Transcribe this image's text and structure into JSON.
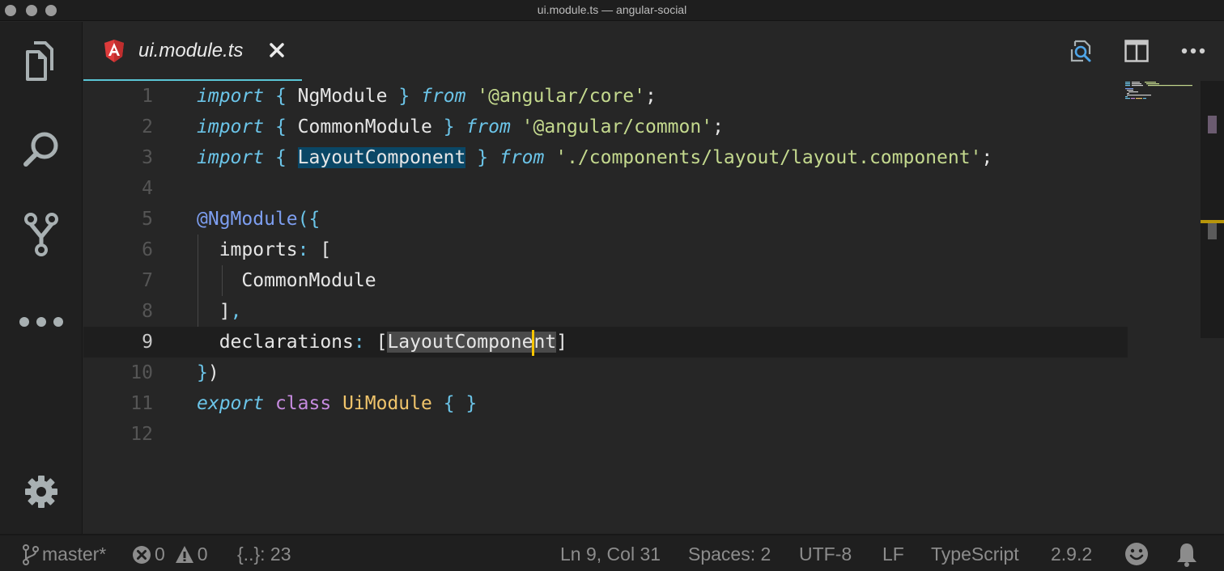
{
  "window": {
    "title": "ui.module.ts — angular-social"
  },
  "activity_bar": {
    "items": [
      {
        "name": "explorer",
        "icon": "files-icon"
      },
      {
        "name": "search",
        "icon": "search-icon"
      },
      {
        "name": "source-control",
        "icon": "source-control-icon"
      },
      {
        "name": "more",
        "icon": "more-icon"
      }
    ],
    "bottom": {
      "name": "settings",
      "icon": "gear-icon"
    }
  },
  "tabs": [
    {
      "label": "ui.module.ts",
      "icon": "angular-icon",
      "active": true,
      "close_icon": "close-icon"
    }
  ],
  "editor_actions": [
    {
      "name": "open-changes",
      "icon": "search-file-icon"
    },
    {
      "name": "split-editor",
      "icon": "split-editor-icon"
    },
    {
      "name": "more-actions",
      "icon": "ellipsis-icon"
    }
  ],
  "editor": {
    "current_line": 9,
    "line_numbers": [
      "1",
      "2",
      "3",
      "4",
      "5",
      "6",
      "7",
      "8",
      "9",
      "10",
      "11",
      "12"
    ],
    "lines": [
      "import { NgModule } from '@angular/core';",
      "import { CommonModule } from '@angular/common';",
      "import { LayoutComponent } from './components/layout/layout.component';",
      "",
      "@NgModule({",
      "  imports: [",
      "    CommonModule",
      "  ],",
      "  declarations: [LayoutComponent]",
      "})",
      "export class UiModule { }",
      ""
    ],
    "tokens": {
      "import": "import",
      "from": "from",
      "lbrace": "{",
      "rbrace": "}",
      "ngmodule": "NgModule",
      "commonmodule": "CommonModule",
      "layoutcomponent": "LayoutComponent",
      "str_core": "'@angular/core'",
      "str_common": "'@angular/common'",
      "str_layout": "'./components/layout/layout.component'",
      "semi": ";",
      "at": "@",
      "decorator_open": "({",
      "imports_key": "imports",
      "colon": ":",
      "lbracket": "[",
      "rbracket": "]",
      "rbracket_comma": "],",
      "declarations_key": "declarations",
      "layout_before_cursor": "LayoutCompone",
      "layout_after_cursor": "nt",
      "close_brace": "}",
      "close_paren": ")",
      "export": "export",
      "class": "class",
      "uimodule": "UiModule"
    }
  },
  "status_bar": {
    "branch": "master*",
    "errors": "0",
    "warnings": "0",
    "symbols": "{..}: 23",
    "cursor_position": "Ln 9, Col 31",
    "indentation": "Spaces: 2",
    "encoding": "UTF-8",
    "eol": "LF",
    "language": "TypeScript",
    "ts_version": "2.9.2"
  }
}
